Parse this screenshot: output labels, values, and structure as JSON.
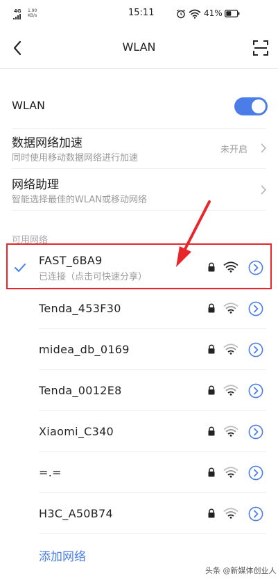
{
  "status_bar": {
    "network": "4G",
    "speed_value": "1.90",
    "speed_unit": "KB/s",
    "time": "15:11",
    "battery": "41%"
  },
  "header": {
    "title": "WLAN"
  },
  "wlan_toggle": {
    "label": "WLAN",
    "enabled": true
  },
  "settings": [
    {
      "title": "数据网络加速",
      "subtitle": "同时使用移动数据网络进行加速",
      "value": "未开启"
    },
    {
      "title": "网络助理",
      "subtitle": "智能选择最佳的WLAN或移动网络",
      "value": ""
    }
  ],
  "section_label": "可用网络",
  "networks": [
    {
      "name": "FAST_6BA9",
      "status": "已连接（点击可快速分享）",
      "connected": true,
      "secured": true
    },
    {
      "name": "Tenda_453F30",
      "status": "",
      "connected": false,
      "secured": true
    },
    {
      "name": "midea_db_0169",
      "status": "",
      "connected": false,
      "secured": true
    },
    {
      "name": "Tenda_0012E8",
      "status": "",
      "connected": false,
      "secured": true
    },
    {
      "name": "Xiaomi_C340",
      "status": "",
      "connected": false,
      "secured": true
    },
    {
      "name": "=.=",
      "status": "",
      "connected": false,
      "secured": true
    },
    {
      "name": "H3C_A50B74",
      "status": "",
      "connected": false,
      "secured": true
    }
  ],
  "add_network_label": "添加网络",
  "watermark": "头条 @新媒体创业人",
  "colors": {
    "accent": "#4a7de8",
    "highlight": "#e8262a"
  }
}
